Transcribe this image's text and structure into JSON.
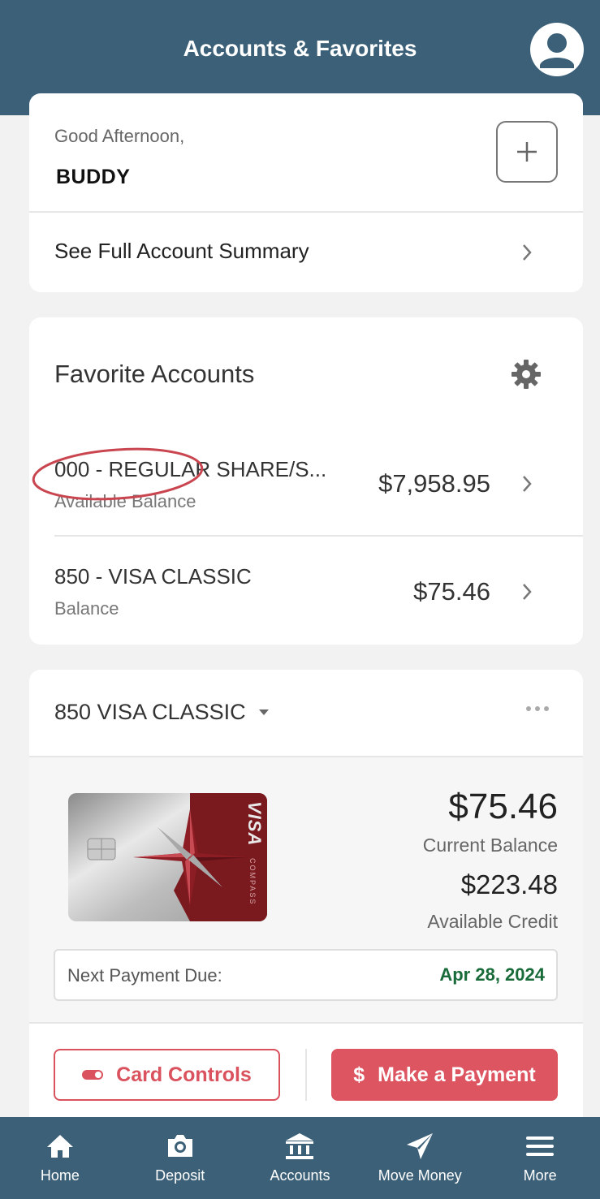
{
  "header": {
    "title": "Accounts & Favorites",
    "profile_icon": "user-avatar-icon"
  },
  "greeting": {
    "salutation": "Good Afternoon,",
    "name": "BUDDY",
    "add_icon": "plus-icon",
    "summary_link": "See Full Account Summary"
  },
  "favorites": {
    "title": "Favorite Accounts",
    "settings_icon": "gear-icon",
    "accounts": [
      {
        "name": "000 - REGULAR SHARE/S...",
        "sub": "Available Balance",
        "amount": "$7,958.95"
      },
      {
        "name": "850 - VISA CLASSIC",
        "sub": "Balance",
        "amount": "$75.46"
      }
    ]
  },
  "visa": {
    "selector": "850 VISA CLASSIC",
    "card_brand": "VISA",
    "card_issuer": "COMPASS",
    "current_balance": "$75.46",
    "current_balance_label": "Current Balance",
    "available_credit": "$223.48",
    "available_credit_label": "Available Credit",
    "next_due_label": "Next Payment Due:",
    "next_due_date": "Apr 28, 2024",
    "controls_label": "Card Controls",
    "pay_symbol": "$",
    "pay_label": "Make a Payment"
  },
  "tabs": [
    {
      "label": "Home",
      "icon": "home-icon"
    },
    {
      "label": "Deposit",
      "icon": "camera-icon"
    },
    {
      "label": "Accounts",
      "icon": "bank-icon"
    },
    {
      "label": "Move Money",
      "icon": "send-icon"
    },
    {
      "label": "More",
      "icon": "menu-icon"
    }
  ],
  "colors": {
    "brand": "#3b6078",
    "accent": "#dc5561",
    "due_date": "#1a6b3a"
  }
}
